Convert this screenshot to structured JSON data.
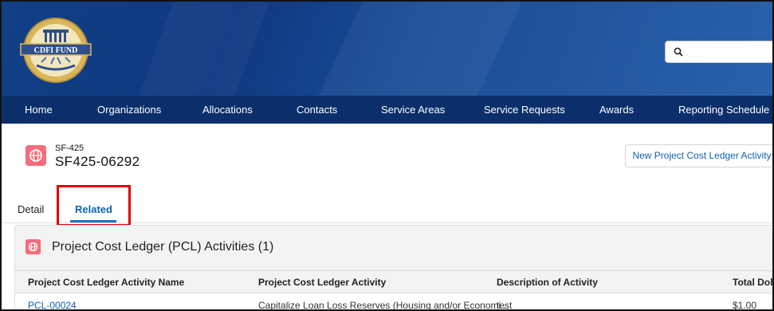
{
  "header": {
    "logo_text": "CDFI FUND",
    "search_placeholder": ""
  },
  "nav": {
    "items": [
      {
        "label": "Home"
      },
      {
        "label": "Organizations"
      },
      {
        "label": "Allocations"
      },
      {
        "label": "Contacts"
      },
      {
        "label": "Service Areas"
      },
      {
        "label": "Service Requests"
      },
      {
        "label": "Awards"
      },
      {
        "label": "Reporting Schedule"
      }
    ]
  },
  "record": {
    "object_type": "SF-425",
    "name": "SF425-06292",
    "new_button_label": "New Project Cost Ledger Activity"
  },
  "tabs": {
    "detail": "Detail",
    "related": "Related",
    "active": "related"
  },
  "related_list": {
    "title": "Project Cost Ledger (PCL) Activities (1)",
    "columns": [
      "Project Cost Ledger Activity Name",
      "Project Cost Ledger Activity",
      "Description of Activity",
      "Total Dolla"
    ],
    "rows": [
      {
        "name": "PCL-00024",
        "activity": "Capitalize Loan Loss Reserves (Housing and/or Economi...",
        "description": "test",
        "total": "$1.00"
      }
    ]
  },
  "colors": {
    "nav_bg": "#0a2f6b",
    "banner": "#123f86",
    "accent": "#0f62b0",
    "record_icon": "#f36d7a",
    "highlight_box": "#e00000"
  }
}
